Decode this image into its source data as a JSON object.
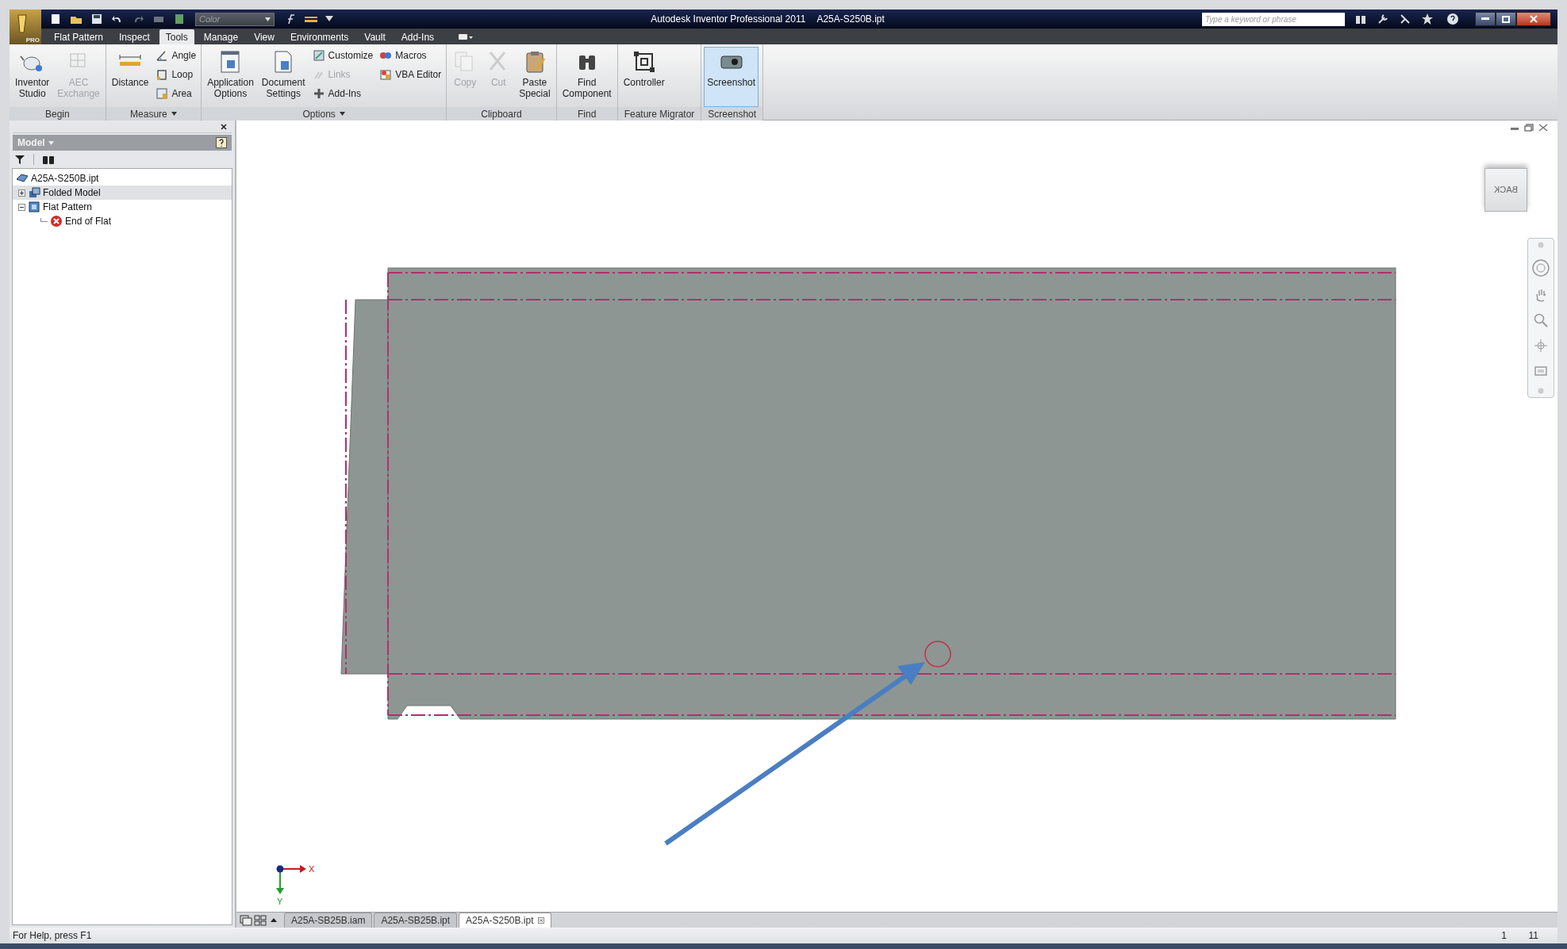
{
  "window": {
    "app_title": "Autodesk Inventor Professional 2011",
    "document": "A25A-S250B.ipt"
  },
  "app_button": {
    "badge": "PRO"
  },
  "quick_access": {
    "style_dropdown": "Color"
  },
  "search": {
    "placeholder": "Type a keyword or phrase"
  },
  "ribbon_tabs": [
    {
      "label": "Flat Pattern",
      "selected": false
    },
    {
      "label": "Inspect",
      "selected": false
    },
    {
      "label": "Tools",
      "selected": true
    },
    {
      "label": "Manage",
      "selected": false
    },
    {
      "label": "View",
      "selected": false
    },
    {
      "label": "Environments",
      "selected": false
    },
    {
      "label": "Vault",
      "selected": false
    },
    {
      "label": "Add-Ins",
      "selected": false
    }
  ],
  "ribbon_panels": [
    {
      "label": "Begin",
      "menu": false,
      "buttons": [
        {
          "label": "Inventor Studio",
          "kind": "large",
          "disabled": false,
          "selected": false
        },
        {
          "label": "AEC Exchange",
          "kind": "large",
          "disabled": true,
          "selected": false
        }
      ]
    },
    {
      "label": "Measure",
      "menu": true,
      "buttons": [
        {
          "label": "Distance",
          "kind": "large",
          "disabled": false,
          "selected": false
        },
        {
          "label": "Angle",
          "kind": "small",
          "disabled": false,
          "selected": false
        },
        {
          "label": "Loop",
          "kind": "small",
          "disabled": false,
          "selected": false
        },
        {
          "label": "Area",
          "kind": "small",
          "disabled": false,
          "selected": false
        }
      ]
    },
    {
      "label": "Options",
      "menu": true,
      "buttons": [
        {
          "label": "Application Options",
          "kind": "large",
          "disabled": false,
          "selected": false
        },
        {
          "label": "Document Settings",
          "kind": "large",
          "disabled": false,
          "selected": false
        },
        {
          "label": "Customize",
          "kind": "small",
          "disabled": false,
          "selected": false
        },
        {
          "label": "Links",
          "kind": "small",
          "disabled": true,
          "selected": false
        },
        {
          "label": "Add-Ins",
          "kind": "small",
          "disabled": false,
          "selected": false
        },
        {
          "label": "Macros",
          "kind": "small",
          "disabled": false,
          "selected": false
        },
        {
          "label": "VBA Editor",
          "kind": "small",
          "disabled": false,
          "selected": false
        }
      ]
    },
    {
      "label": "Clipboard",
      "menu": false,
      "buttons": [
        {
          "label": "Copy",
          "kind": "large",
          "disabled": true,
          "selected": false
        },
        {
          "label": "Cut",
          "kind": "large",
          "disabled": true,
          "selected": false
        },
        {
          "label": "Paste Special",
          "kind": "large",
          "disabled": false,
          "selected": false
        }
      ]
    },
    {
      "label": "Find",
      "menu": false,
      "buttons": [
        {
          "label": "Find Component",
          "kind": "large",
          "disabled": false,
          "selected": false
        }
      ]
    },
    {
      "label": "Feature Migrator",
      "menu": false,
      "buttons": [
        {
          "label": "Controller",
          "kind": "large",
          "disabled": false,
          "selected": false
        }
      ]
    },
    {
      "label": "Screenshot",
      "menu": false,
      "buttons": [
        {
          "label": "Screenshot",
          "kind": "large",
          "disabled": false,
          "selected": true
        }
      ]
    }
  ],
  "browser": {
    "title": "Model",
    "tree": [
      {
        "label": "A25A-S250B.ipt",
        "kind": "part",
        "selected": false,
        "children": [
          {
            "label": "Folded Model",
            "kind": "folded",
            "selected": true,
            "expanded": false
          },
          {
            "label": "Flat Pattern",
            "kind": "flat",
            "selected": false,
            "expanded": true,
            "children": [
              {
                "label": "End of Flat",
                "kind": "end",
                "selected": false
              }
            ]
          }
        ]
      }
    ]
  },
  "viewport": {
    "view_cube": "BACK",
    "axis_labels": [
      "X",
      "Y"
    ]
  },
  "document_tabs": [
    {
      "label": "A25A-SB25B.iam",
      "selected": false
    },
    {
      "label": "A25A-SB25B.ipt",
      "selected": false
    },
    {
      "label": "A25A-S250B.ipt",
      "selected": true
    }
  ],
  "status_bar": {
    "help": "For Help, press F1",
    "field_1": "1",
    "field_2": "11"
  }
}
